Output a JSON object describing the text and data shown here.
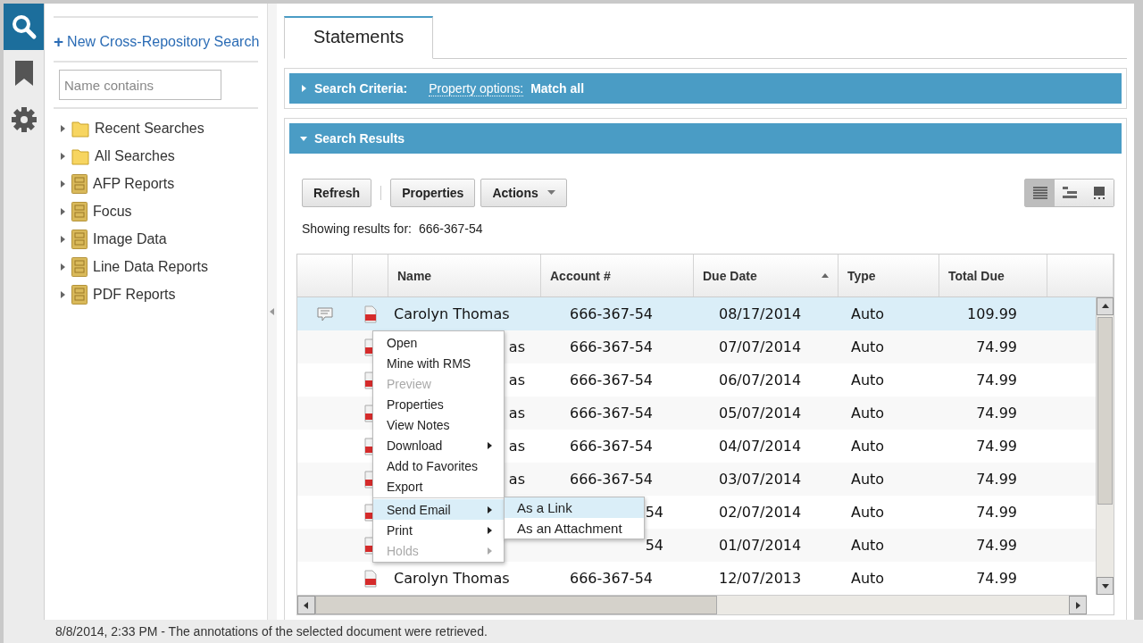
{
  "rail": [
    {
      "selected": true
    },
    {
      "selected": false
    },
    {
      "selected": false
    }
  ],
  "sidebar": {
    "new_search": "New Cross-Repository Search",
    "new_search_mark": "+",
    "filter": {
      "placeholder": "Name contains"
    },
    "items": [
      {
        "label": "Recent Searches",
        "kind": "folder",
        "expanded": false
      },
      {
        "label": "All Searches",
        "kind": "folder",
        "expanded": false
      },
      {
        "label": "AFP Reports",
        "kind": "repository",
        "expanded": false
      },
      {
        "label": "Focus",
        "kind": "repository",
        "expanded": false
      },
      {
        "label": "Image Data",
        "kind": "repository",
        "expanded": false
      },
      {
        "label": "Line Data Reports",
        "kind": "repository",
        "expanded": false
      },
      {
        "label": "PDF Reports",
        "kind": "repository",
        "expanded": false
      }
    ]
  },
  "tabs": [
    {
      "label": "Statements",
      "selected": true
    }
  ],
  "criteria": {
    "title": "Search Criteria:",
    "expanded": false,
    "option_label": "Property options:",
    "option_value": "Match all"
  },
  "results": {
    "title": "Search Results",
    "expanded": true,
    "toolbar": [
      {
        "label": "Refresh",
        "kind": "button"
      },
      {
        "label": "Properties",
        "kind": "button"
      },
      {
        "label": "Actions",
        "kind": "dropdown"
      }
    ],
    "views": [
      {
        "selected": true
      },
      {
        "selected": false
      },
      {
        "selected": false
      }
    ],
    "showing_label": "Showing results for:",
    "showing_value": "666-367-54",
    "columns": [
      {
        "label": "Name",
        "sorted": false
      },
      {
        "label": "Account #",
        "sorted": false
      },
      {
        "label": "Due Date",
        "sorted": true
      },
      {
        "label": "Type",
        "sorted": false
      },
      {
        "label": "Total Due",
        "sorted": false
      }
    ],
    "rows": [
      {
        "kind": "plain",
        "name": "Carolyn Thomas",
        "has_note": true,
        "selected": true,
        "account": "666-367-54",
        "due": "08/17/2014",
        "type": "Auto",
        "total": "109.99"
      },
      {
        "kind": "name_covered",
        "name": "as",
        "has_note": false,
        "selected": false,
        "account": "666-367-54",
        "due": "07/07/2014",
        "type": "Auto",
        "total": "74.99"
      },
      {
        "kind": "name_covered",
        "name": "as",
        "has_note": false,
        "selected": false,
        "account": "666-367-54",
        "due": "06/07/2014",
        "type": "Auto",
        "total": "74.99"
      },
      {
        "kind": "name_covered",
        "name": "as",
        "has_note": false,
        "selected": false,
        "account": "666-367-54",
        "due": "05/07/2014",
        "type": "Auto",
        "total": "74.99"
      },
      {
        "kind": "name_covered",
        "name": "as",
        "has_note": false,
        "selected": false,
        "account": "666-367-54",
        "due": "04/07/2014",
        "type": "Auto",
        "total": "74.99"
      },
      {
        "kind": "name_covered",
        "name": "as",
        "has_note": false,
        "selected": false,
        "account": "666-367-54",
        "due": "03/07/2014",
        "type": "Auto",
        "total": "74.99"
      },
      {
        "kind": "account_covered",
        "has_note": false,
        "selected": false,
        "account": "54",
        "due": "02/07/2014",
        "type": "Auto",
        "total": "74.99"
      },
      {
        "kind": "account_covered",
        "has_note": false,
        "selected": false,
        "account": "54",
        "due": "01/07/2014",
        "type": "Auto",
        "total": "74.99"
      },
      {
        "kind": "plain",
        "name": "Carolyn Thomas",
        "has_note": false,
        "selected": false,
        "account": "666-367-54",
        "due": "12/07/2013",
        "type": "Auto",
        "total": "74.99"
      }
    ]
  },
  "context_menu": [
    {
      "label": "Open",
      "disabled": false,
      "submenu": false,
      "highlighted": false
    },
    {
      "label": "Mine with RMS",
      "disabled": false,
      "submenu": false,
      "highlighted": false
    },
    {
      "label": "Preview",
      "disabled": true,
      "submenu": false,
      "highlighted": false
    },
    {
      "label": "Properties",
      "disabled": false,
      "submenu": false,
      "highlighted": false
    },
    {
      "label": "View Notes",
      "disabled": false,
      "submenu": false,
      "highlighted": false
    },
    {
      "label": "Download",
      "disabled": false,
      "submenu": true,
      "highlighted": false
    },
    {
      "label": "Add to Favorites",
      "disabled": false,
      "submenu": false,
      "highlighted": false
    },
    {
      "label": "Export",
      "disabled": false,
      "submenu": false,
      "highlighted": false
    },
    {
      "label": "Send Email",
      "disabled": false,
      "submenu": true,
      "highlighted": true
    },
    {
      "label": "Print",
      "disabled": false,
      "submenu": true,
      "highlighted": false
    },
    {
      "label": "Holds",
      "disabled": true,
      "submenu": true,
      "highlighted": false
    }
  ],
  "submenu": [
    {
      "label": "As a Link",
      "selected": true
    },
    {
      "label": "As an Attachment",
      "selected": false
    }
  ],
  "status_bar": "8/8/2014, 2:33 PM - The annotations of the selected document were retrieved."
}
